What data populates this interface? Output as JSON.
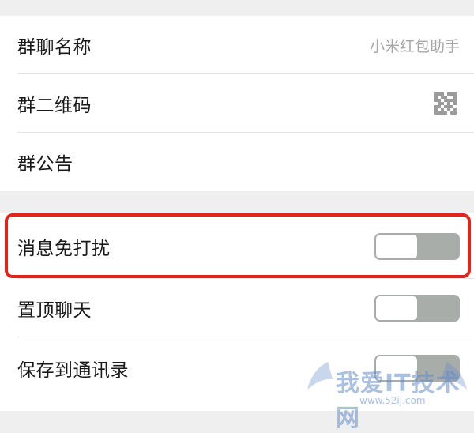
{
  "group_info": {
    "rows": [
      {
        "label": "群聊名称",
        "value": "小米红包助手"
      },
      {
        "label": "群二维码",
        "icon": "qr-code-icon"
      },
      {
        "label": "群公告"
      }
    ]
  },
  "settings": {
    "rows": [
      {
        "label": "消息免打扰",
        "toggle": "off"
      },
      {
        "label": "置顶聊天",
        "toggle": "off"
      },
      {
        "label": "保存到通讯录",
        "toggle": "off"
      }
    ]
  },
  "highlight_color": "#e2241b",
  "watermark": {
    "text": "我爱IT技术网",
    "url": "www.52ij.com"
  }
}
